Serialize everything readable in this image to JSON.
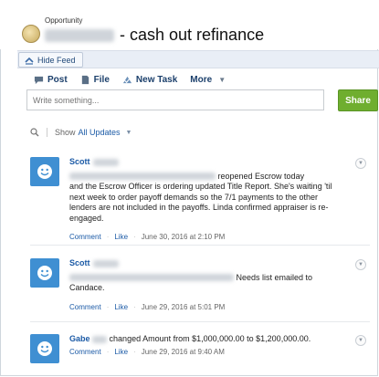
{
  "header": {
    "object_label": "Opportunity",
    "title_suffix": "- cash out refinance"
  },
  "hide_feed": {
    "label": "Hide Feed"
  },
  "publisher": {
    "tabs": [
      {
        "label": "Post",
        "icon": "speech-bubble-icon"
      },
      {
        "label": "File",
        "icon": "file-icon"
      },
      {
        "label": "New Task",
        "icon": "task-icon"
      },
      {
        "label": "More"
      }
    ],
    "placeholder": "Write something...",
    "share_label": "Share"
  },
  "filter": {
    "show_label": "Show",
    "selected": "All Updates"
  },
  "feed": [
    {
      "author": "Scott",
      "line1_tail": "reopened Escrow today",
      "text": "and the Escrow Officer is ordering updated Title Report.  She's waiting 'til next week to order payoff demands so the 7/1 payments to the other lenders are not included in the payoffs. Linda confirmed appraiser is re-engaged.",
      "comment": "Comment",
      "like": "Like",
      "timestamp": "June 30, 2016 at 2:10 PM"
    },
    {
      "author": "Scott",
      "line1_tail": "Needs list emailed to",
      "text": "Candace.",
      "comment": "Comment",
      "like": "Like",
      "timestamp": "June 29, 2016 at 5:01 PM"
    },
    {
      "author": "Gabe",
      "line1_tail": "changed Amount from $1,000,000.00 to $1,200,000.00.",
      "comment": "Comment",
      "like": "Like",
      "timestamp": "June 29, 2016 at 9:40 AM"
    }
  ],
  "colors": {
    "accent": "#1b5aa6",
    "share": "#6fae2f",
    "avatar": "#3f8fd2"
  }
}
